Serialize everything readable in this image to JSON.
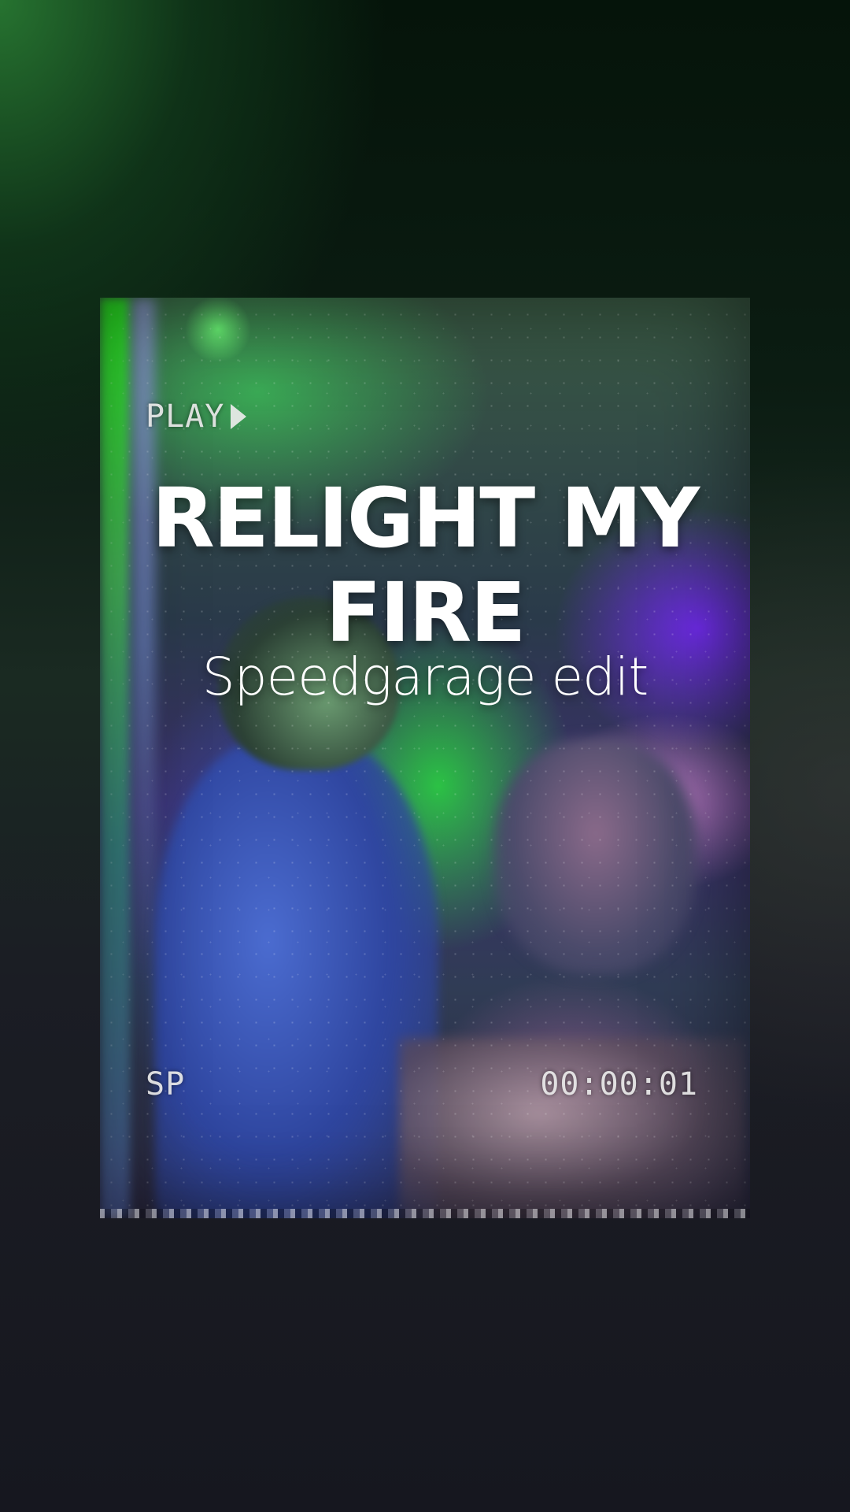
{
  "overlay": {
    "play_label": "PLAY",
    "play_icon": "play-triangle-icon",
    "mode_label": "SP",
    "timecode": "00:00:01"
  },
  "title": {
    "main": "RELIGHT MY FIRE",
    "subtitle": "Speedgarage edit"
  },
  "colors": {
    "background_top": "#1e5a2a",
    "background_bottom": "#16171f",
    "title_text": "#ffffff",
    "vcr_text": "#ebebeb",
    "neon_green": "#2aff20",
    "neon_purple": "#7828ff"
  }
}
